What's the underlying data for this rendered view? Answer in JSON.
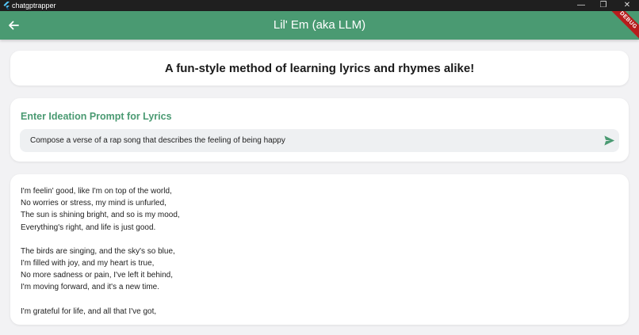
{
  "window": {
    "title": "chatgptrapper",
    "controls": {
      "minimize": "—",
      "maximize": "❐",
      "close": "✕"
    }
  },
  "appbar": {
    "title": "Lil' Em (aka LLM)",
    "back_icon": "arrow-left-icon",
    "debug_label": "DEBUG",
    "color": "#4a9a72"
  },
  "header": {
    "headline": "A fun-style method of learning lyrics and rhymes alike!"
  },
  "prompt": {
    "label": "Enter Ideation Prompt for Lyrics",
    "value": "Compose a verse of a rap song that describes the feeling of being happy",
    "send_icon": "send-icon"
  },
  "lyrics": {
    "stanzas": [
      [
        "I'm feelin' good, like I'm on top of the world,",
        "No worries or stress, my mind is unfurled,",
        "The sun is shining bright, and so is my mood,",
        "Everything's right, and life is just good."
      ],
      [
        "The birds are singing, and the sky's so blue,",
        "I'm filled with joy, and my heart is true,",
        "No more sadness or pain, I've left it behind,",
        "I'm moving forward, and it's a new time."
      ],
      [
        "I'm grateful for life, and all that I've got,"
      ]
    ]
  }
}
